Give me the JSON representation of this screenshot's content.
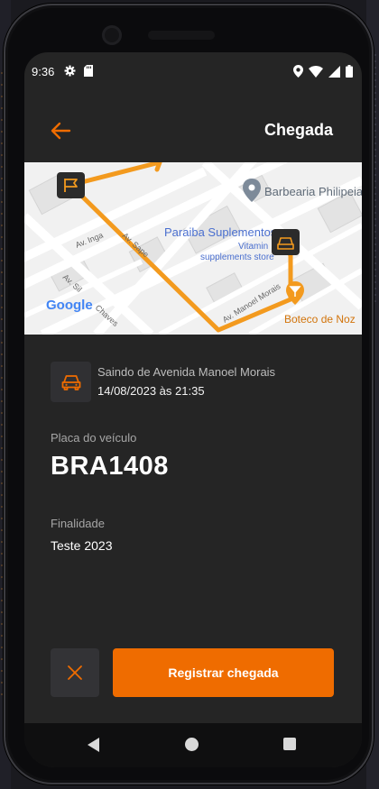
{
  "status": {
    "time": "9:36"
  },
  "header": {
    "title": "Chegada"
  },
  "map": {
    "places": [
      "Barbearia Philipeia",
      "Paraiba Suplementos",
      "Vitamin",
      "supplements store",
      "Boteco de Noz"
    ],
    "streets": [
      "Av. Inga",
      "Av. Sape",
      "Av. Manoel Morais",
      "Av. Sil",
      "Chaves"
    ],
    "attribution": "Google",
    "route_color": "#f39a1e"
  },
  "trip": {
    "origin": "Saindo de Avenida Manoel Morais",
    "datetime": "14/08/2023 às 21:35",
    "plate_label": "Placa do veículo",
    "plate": "BRA1408",
    "purpose_label": "Finalidade",
    "purpose": "Teste 2023"
  },
  "actions": {
    "register_label": "Registrar chegada"
  },
  "colors": {
    "accent": "#ef6c00",
    "background": "#252525"
  }
}
